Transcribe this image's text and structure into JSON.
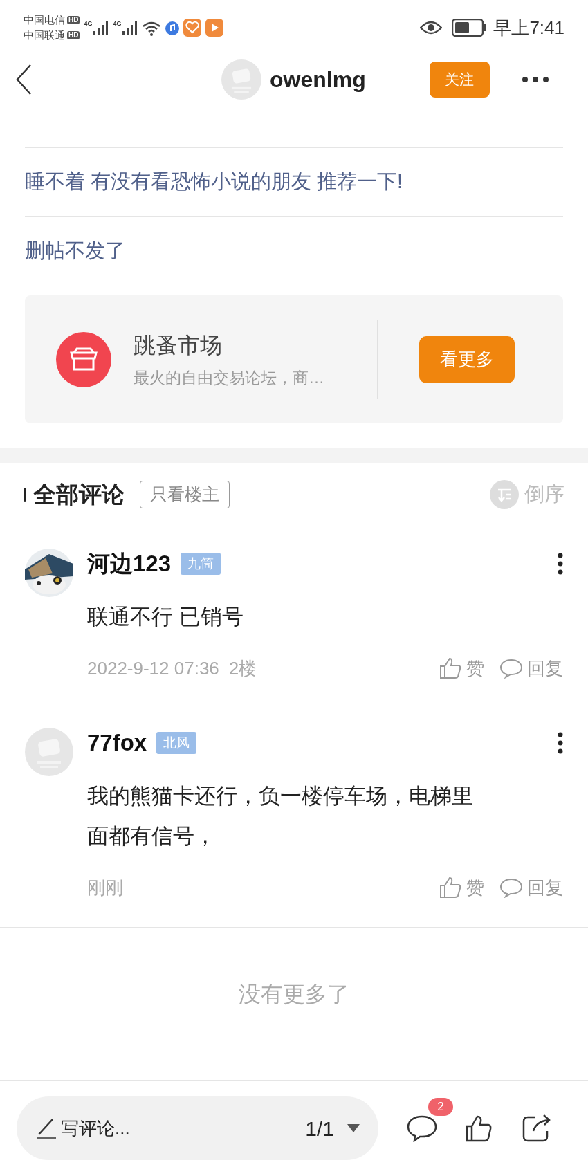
{
  "status_bar": {
    "carriers": [
      {
        "name": "中国电信",
        "badge": "HD"
      },
      {
        "name": "中国联通",
        "badge": "HD"
      }
    ],
    "networks": [
      "4G",
      "4G"
    ],
    "time": "早上7:41"
  },
  "header": {
    "username": "owenlmg",
    "follow_button": "关注"
  },
  "posts": [
    {
      "title": "睡不着 有没有看恐怖小说的朋友 推荐一下!"
    },
    {
      "title": "删帖不发了"
    }
  ],
  "forum_card": {
    "name": "跳蚤市场",
    "description": "最火的自由交易论坛，商…",
    "button": "看更多"
  },
  "comments_header": {
    "title": "全部评论",
    "filter": "只看楼主",
    "sort": "倒序"
  },
  "comments": [
    {
      "author": "河边123",
      "badge": "九筒",
      "kind": "photo",
      "text_lines": [
        "联通不行 已销号"
      ],
      "time": "2022-9-12 07:36",
      "floor": "2楼",
      "like": "赞",
      "reply": "回复"
    },
    {
      "author": "77fox",
      "badge": "北风",
      "kind": "default",
      "text_lines": [
        "我的熊猫卡还行，负一楼停车场，电梯里",
        "面都有信号，"
      ],
      "time": "刚刚",
      "like": "赞",
      "reply": "回复"
    }
  ],
  "end_note": "没有更多了",
  "bottom_bar": {
    "placeholder": "写评论...",
    "page": "1/1",
    "comment_count": "2"
  }
}
